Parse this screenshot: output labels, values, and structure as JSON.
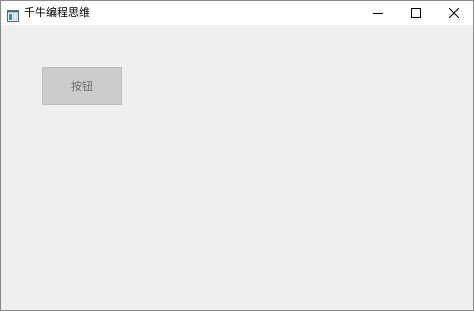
{
  "window": {
    "title": "千牛编程思维",
    "icon": "app-window-icon",
    "controls": {
      "minimize_icon": "minimize-icon",
      "maximize_icon": "maximize-icon",
      "close_icon": "close-icon"
    }
  },
  "main": {
    "button_label": "按钮"
  },
  "colors": {
    "client_background": "#efefef",
    "button_background": "#cccccc",
    "button_text": "#6d6d6d",
    "titlebar_background": "#ffffff"
  }
}
